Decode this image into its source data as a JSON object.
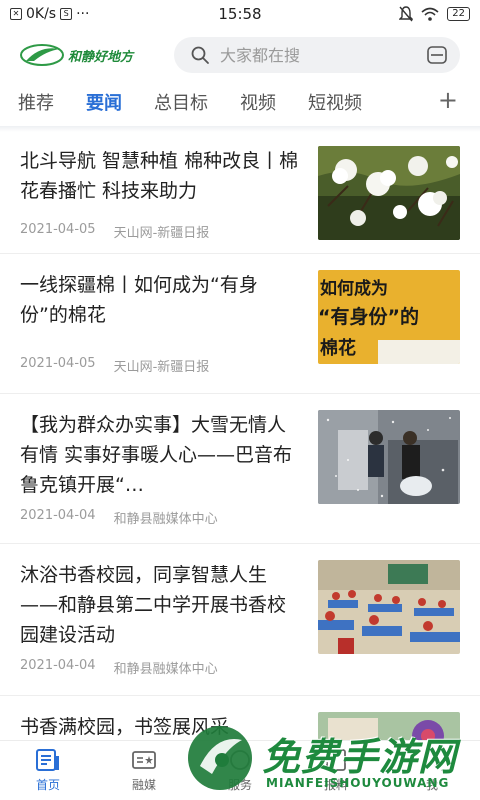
{
  "status_bar": {
    "speed": "0K/s",
    "time": "15:58",
    "battery": "22"
  },
  "header": {
    "logo_text": "和静好地方",
    "search_placeholder": "大家都在搜"
  },
  "tabs": [
    {
      "label": "推荐",
      "active": false
    },
    {
      "label": "要闻",
      "active": true
    },
    {
      "label": "总目标",
      "active": false
    },
    {
      "label": "视频",
      "active": false
    },
    {
      "label": "短视频",
      "active": false
    }
  ],
  "news": [
    {
      "title": "北斗导航 智慧种植 棉种改良丨棉花春播忙 科技来助力",
      "date": "2021-04-05",
      "source": "天山网-新疆日报",
      "thumb": "cotton"
    },
    {
      "title": "一线探疆棉丨如何成为“有身份”的棉花",
      "date": "2021-04-05",
      "source": "天山网-新疆日报",
      "thumb": "poster",
      "thumb_text": [
        "如何成为",
        "“有身份”的",
        "棉花"
      ]
    },
    {
      "title": "【我为群众办实事】大雪无情人有情  实事好事暖人心——巴音布鲁克镇开展“…",
      "date": "2021-04-04",
      "source": "和静县融媒体中心",
      "thumb": "snow"
    },
    {
      "title": "沐浴书香校园，同享智慧人生——和静县第二中学开展书香校园建设活动",
      "date": "2021-04-04",
      "source": "和静县融媒体中心",
      "thumb": "classroom"
    },
    {
      "title": "书香满校园，书签展风采",
      "date": "",
      "source": "",
      "thumb": "bookmark"
    }
  ],
  "bottom_nav": [
    {
      "label": "首页",
      "icon": "news-icon",
      "active": true
    },
    {
      "label": "融媒",
      "icon": "media-icon",
      "active": false
    },
    {
      "label": "服务",
      "icon": "service-icon",
      "active": false
    },
    {
      "label": "报料",
      "icon": "report-icon",
      "active": false
    },
    {
      "label": "我",
      "icon": "user-icon",
      "active": false
    }
  ],
  "watermark": {
    "title": "免费手游网",
    "subtitle": "MIANFEISHOUYOUWANG"
  },
  "colors": {
    "accent": "#2a6fd6",
    "brand_green": "#1f8a3a",
    "meta_gray": "#9b9b9b"
  }
}
